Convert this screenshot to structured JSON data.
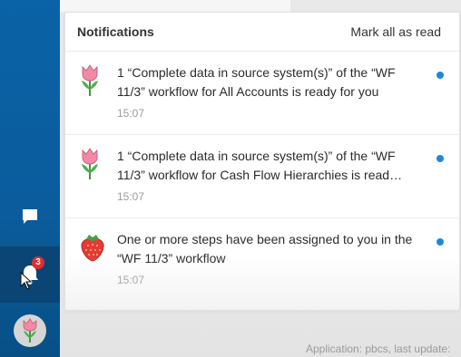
{
  "panel": {
    "title": "Notifications",
    "mark_all_label": "Mark all as read"
  },
  "notifications": [
    {
      "icon": "tulip-icon",
      "message": "1 “Complete data in source system(s)” of the “WF 11/3” workflow for All Accounts is ready for you",
      "time": "15:07",
      "unread": true
    },
    {
      "icon": "tulip-icon",
      "message": "1 “Complete data in source system(s)” of the “WF 11/3” workflow for Cash Flow Hierarchies is read…",
      "time": "15:07",
      "unread": true
    },
    {
      "icon": "strawberry-icon",
      "message": "One or more steps have been assigned to you in the “WF 11/3” workflow",
      "time": "15:07",
      "unread": true
    }
  ],
  "sidebar": {
    "bell_badge": "3"
  },
  "footer": {
    "text": "Application: pbcs, last update:"
  },
  "colors": {
    "sidebar": "#0a63a6",
    "unread_dot": "#1e88d8",
    "badge": "#e02d2d"
  }
}
